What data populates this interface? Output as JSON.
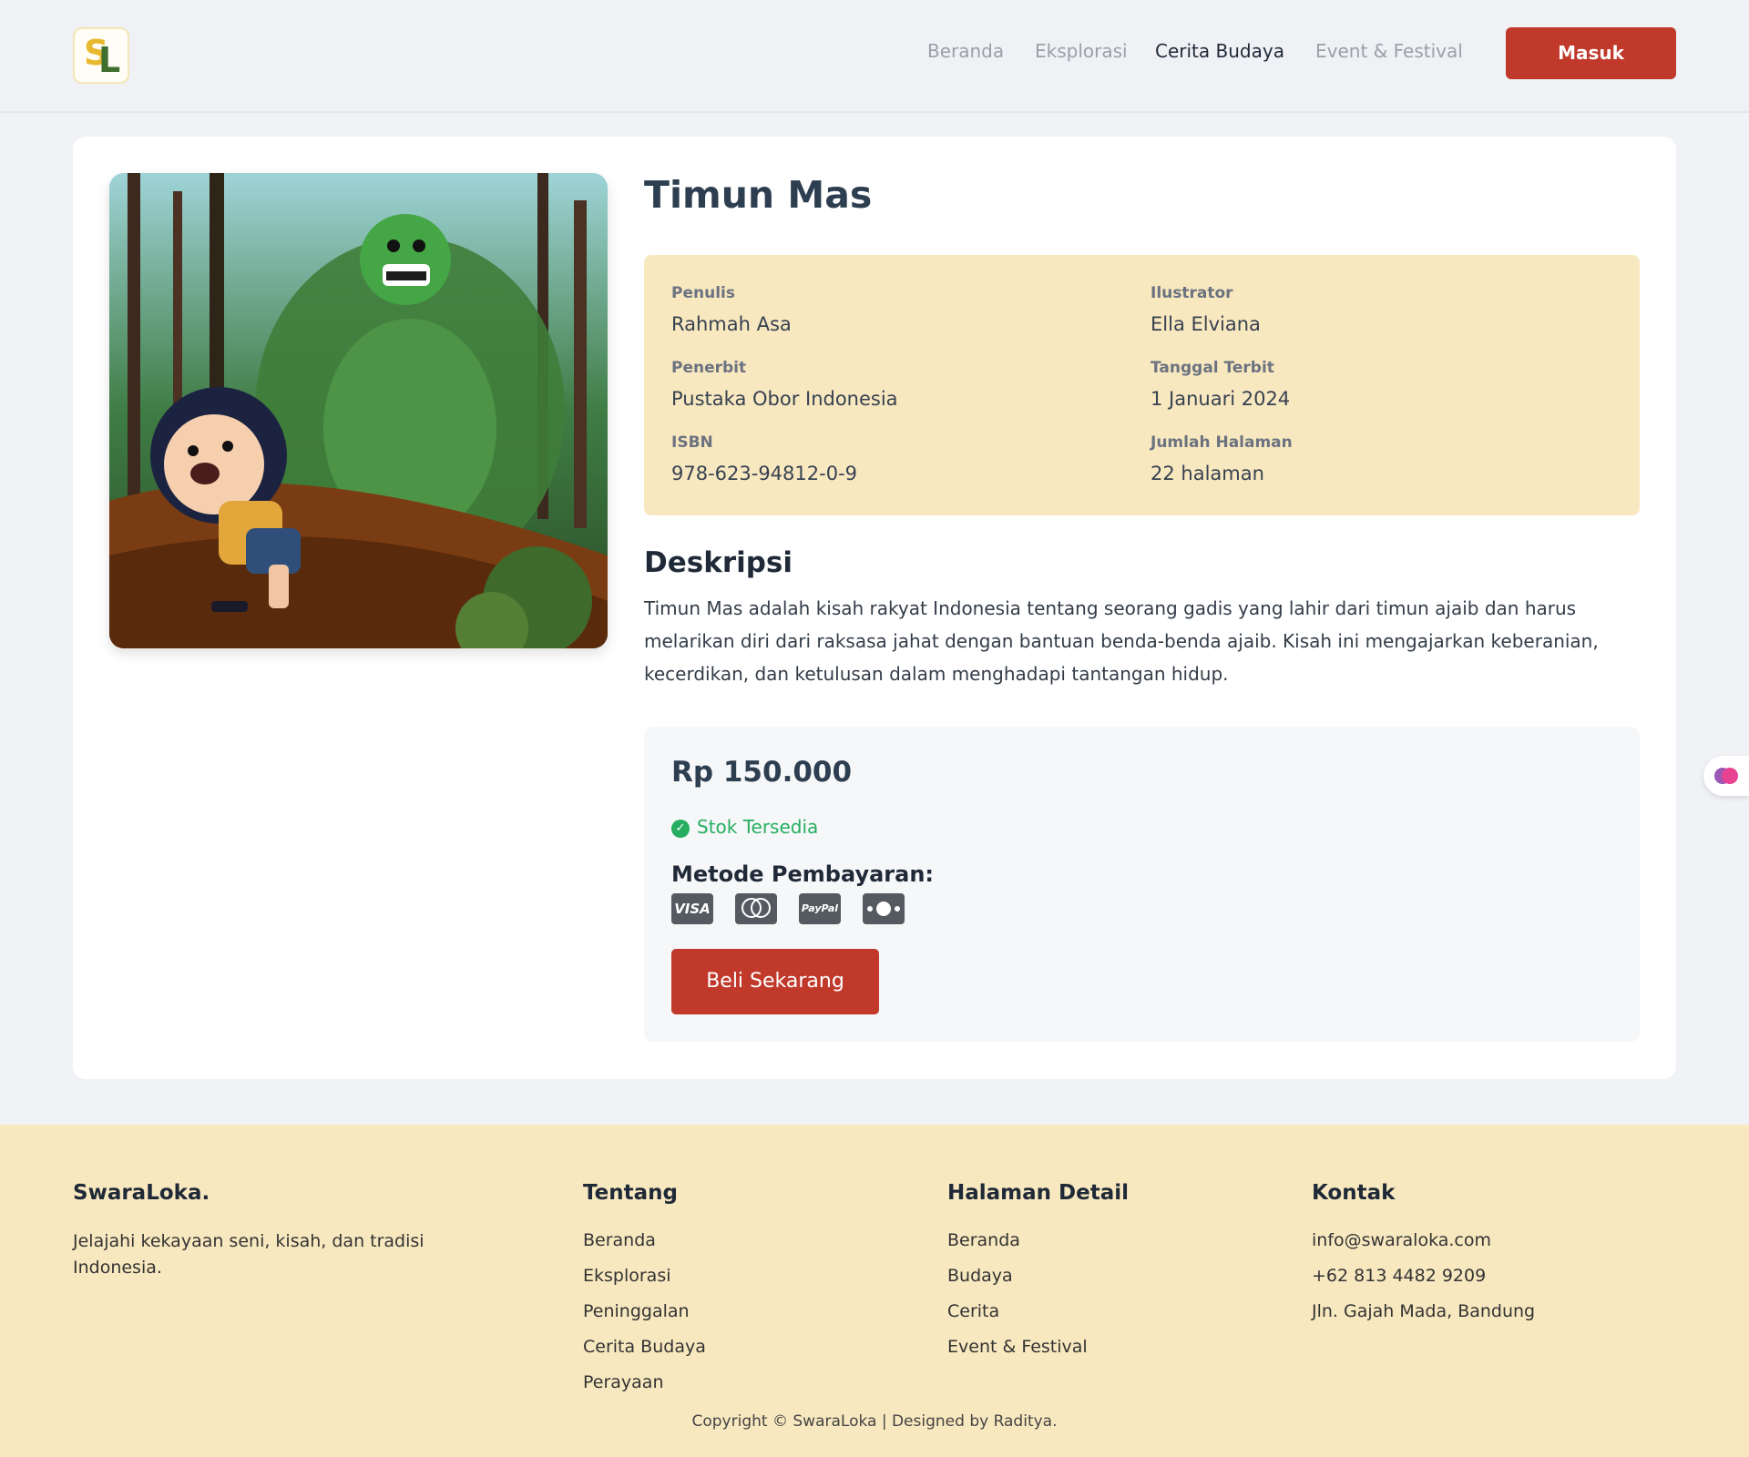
{
  "header": {
    "logo_s": "S",
    "logo_l": "L",
    "nav": [
      "Beranda",
      "Eksplorasi",
      "Cerita Budaya",
      "Event & Festival"
    ],
    "active_nav": "Cerita Budaya",
    "login_label": "Masuk"
  },
  "book": {
    "title": "Timun Mas",
    "info": {
      "penulis_label": "Penulis",
      "penulis": "Rahmah Asa",
      "ilustrator_label": "Ilustrator",
      "ilustrator": "Ella Elviana",
      "penerbit_label": "Penerbit",
      "penerbit": "Pustaka Obor Indonesia",
      "tanggal_label": "Tanggal Terbit",
      "tanggal": "1 Januari 2024",
      "isbn_label": "ISBN",
      "isbn": "978-623-94812-0-9",
      "halaman_label": "Jumlah Halaman",
      "halaman": "22 halaman"
    },
    "desc_title": "Deskripsi",
    "description": "Timun Mas adalah kisah rakyat Indonesia tentang seorang gadis yang lahir dari timun ajaib dan harus melarikan diri dari raksasa jahat dengan bantuan benda-benda ajaib. Kisah ini mengajarkan keberanian, kecerdikan, dan ketulusan dalam menghadapi tantangan hidup."
  },
  "purchase": {
    "price": "Rp 150.000",
    "stock": "Stok Tersedia",
    "payment_title": "Metode Pembayaran:",
    "payment_icons": [
      "visa-icon",
      "mastercard-icon",
      "paypal-icon",
      "cash-icon"
    ],
    "visa_text": "VISA",
    "paypal_text": "PayPal",
    "buy_label": "Beli Sekarang"
  },
  "footer": {
    "brand": "SwaraLoka.",
    "tagline": "Jelajahi kekayaan seni, kisah, dan tradisi Indonesia.",
    "tentang_title": "Tentang",
    "tentang": [
      "Beranda",
      "Eksplorasi",
      "Peninggalan",
      "Cerita Budaya",
      "Perayaan"
    ],
    "detail_title": "Halaman Detail",
    "detail": [
      "Beranda",
      "Budaya",
      "Cerita",
      "Event & Festival"
    ],
    "kontak_title": "Kontak",
    "kontak": [
      "info@swaraloka.com",
      "+62 813 4482 9209",
      "Jln. Gajah Mada, Bandung"
    ],
    "copyright": "Copyright © SwaraLoka | Designed by Raditya."
  },
  "colors": {
    "accent": "#c0392b",
    "cream": "#f8e8bf",
    "success": "#27ae60"
  }
}
